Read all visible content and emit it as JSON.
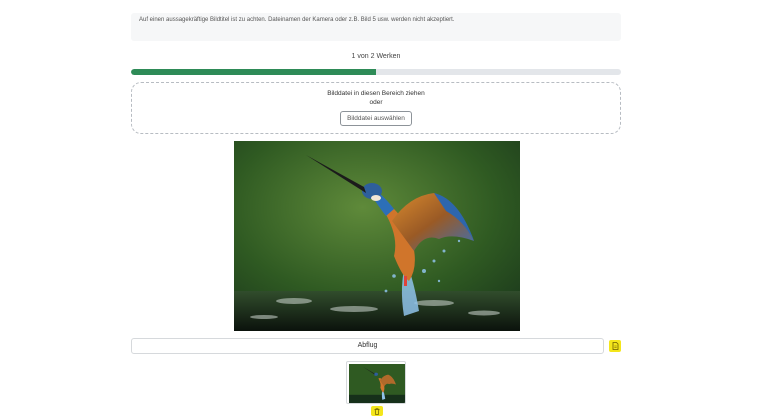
{
  "notice": {
    "text": "Auf einen aussagekräftige Bildtitel ist zu achten. Dateinamen der Kamera oder z.B. Bild 5 usw. werden nicht akzeptiert."
  },
  "progress": {
    "label": "1 von 2 Werken",
    "current": 1,
    "total": 2,
    "fill_fraction": 0.5,
    "color": "#2e8b57"
  },
  "dropzone": {
    "prompt": "Bilddatei in diesen Bereich ziehen",
    "or": "oder",
    "button_label": "Bilddatei auswählen"
  },
  "image": {
    "subject": "kingfisher-photo"
  },
  "title_field": {
    "value": "Abflug",
    "action_icon": "file-icon",
    "action_color": "#f4e61b"
  },
  "thumbnail": {
    "delete_icon": "trash-icon",
    "delete_color": "#f4e61b"
  }
}
